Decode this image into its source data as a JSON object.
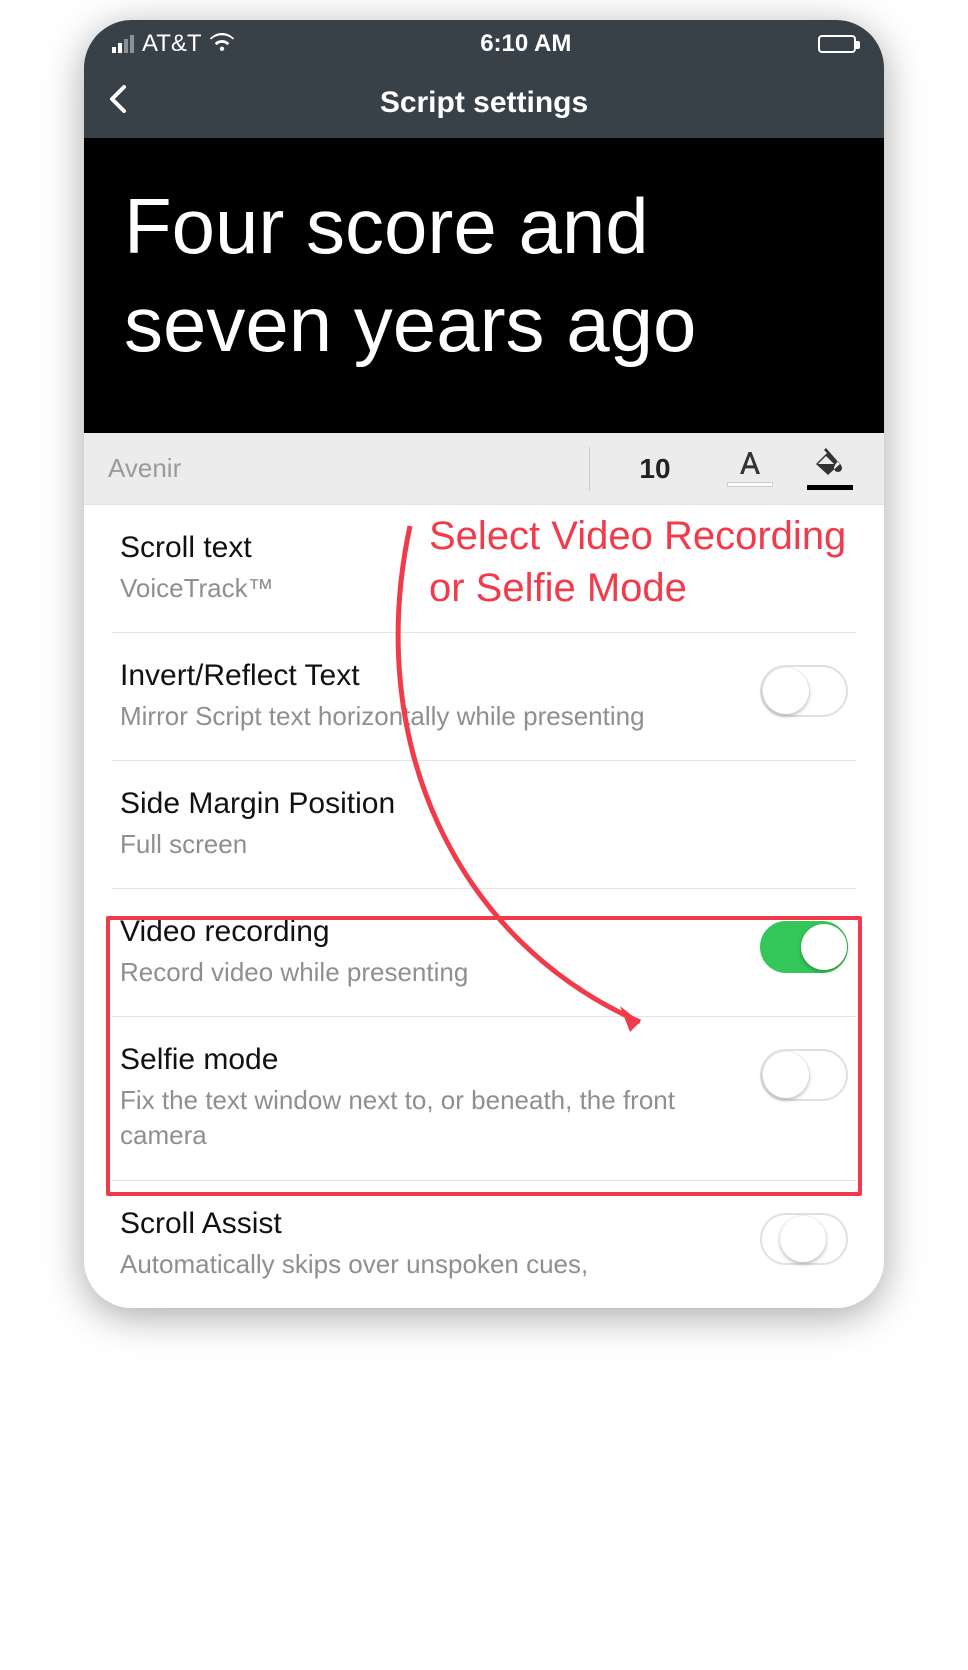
{
  "statusbar": {
    "carrier": "AT&T",
    "time": "6:10 AM"
  },
  "navbar": {
    "title": "Script settings"
  },
  "preview": {
    "text": "Four score and seven years ago"
  },
  "fontbar": {
    "font_name": "Avenir",
    "font_size": "10"
  },
  "settings": {
    "scroll_text": {
      "title": "Scroll text",
      "subtitle": "VoiceTrack™"
    },
    "invert_reflect": {
      "title": "Invert/Reflect Text",
      "subtitle": "Mirror Script text horizontally while presenting",
      "on": false
    },
    "side_margin": {
      "title": "Side Margin Position",
      "subtitle": "Full screen"
    },
    "video_recording": {
      "title": "Video recording",
      "subtitle": "Record video while presenting",
      "on": true
    },
    "selfie_mode": {
      "title": "Selfie mode",
      "subtitle": "Fix the text window next to, or beneath, the front camera",
      "on": false
    },
    "scroll_assist": {
      "title": "Scroll Assist",
      "subtitle": "Automatically skips over unspoken cues,"
    }
  },
  "annotation": {
    "text": "Select Video Recording or Selfie Mode"
  }
}
